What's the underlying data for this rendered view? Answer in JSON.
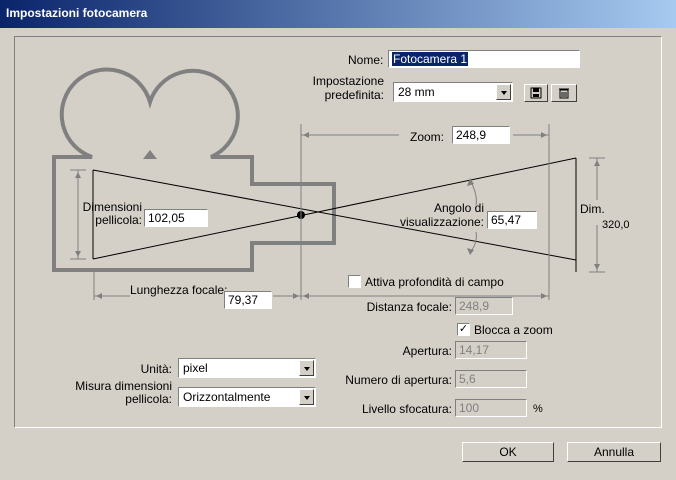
{
  "window": {
    "title": "Impostazioni fotocamera"
  },
  "camera": {
    "name_label": "Nome:",
    "name_value": "Fotocamera 1",
    "preset_label_1": "Impostazione",
    "preset_label_2": "predefinita:",
    "preset_value": "28 mm",
    "zoom_label": "Zoom:",
    "zoom_value": "248,9",
    "film_label_1": "Dimensioni",
    "film_label_2": "pellicola:",
    "film_value": "102,05",
    "angle_label_1": "Angolo di",
    "angle_label_2": "visualizzazione:",
    "angle_value": "65,47",
    "dim_label": "Dim.",
    "dim_value": "320,0",
    "focal_label": "Lunghezza focale:",
    "focal_value": "79,37"
  },
  "dof": {
    "enable_label": "Attiva profondità di campo",
    "enable_checked": false,
    "focus_dist_label": "Distanza focale:",
    "focus_dist_value": "248,9",
    "lock_label": "Blocca a zoom",
    "lock_checked": true,
    "aperture_label": "Apertura:",
    "aperture_value": "14,17",
    "fstop_label": "Numero di apertura:",
    "fstop_value": "5,6",
    "blur_label": "Livello sfocatura:",
    "blur_value": "100",
    "blur_unit": "%"
  },
  "units": {
    "label": "Unità:",
    "value": "pixel",
    "film_size_label_1": "Misura dimensioni",
    "film_size_label_2": "pellicola:",
    "film_size_value": "Orizzontalmente"
  },
  "buttons": {
    "ok": "OK",
    "cancel": "Annulla"
  },
  "icons": {
    "save": "save-icon",
    "delete": "trash-icon"
  },
  "colors": {
    "title_start": "#0a246a",
    "title_end": "#a6caf0",
    "diagram": "#808080"
  }
}
